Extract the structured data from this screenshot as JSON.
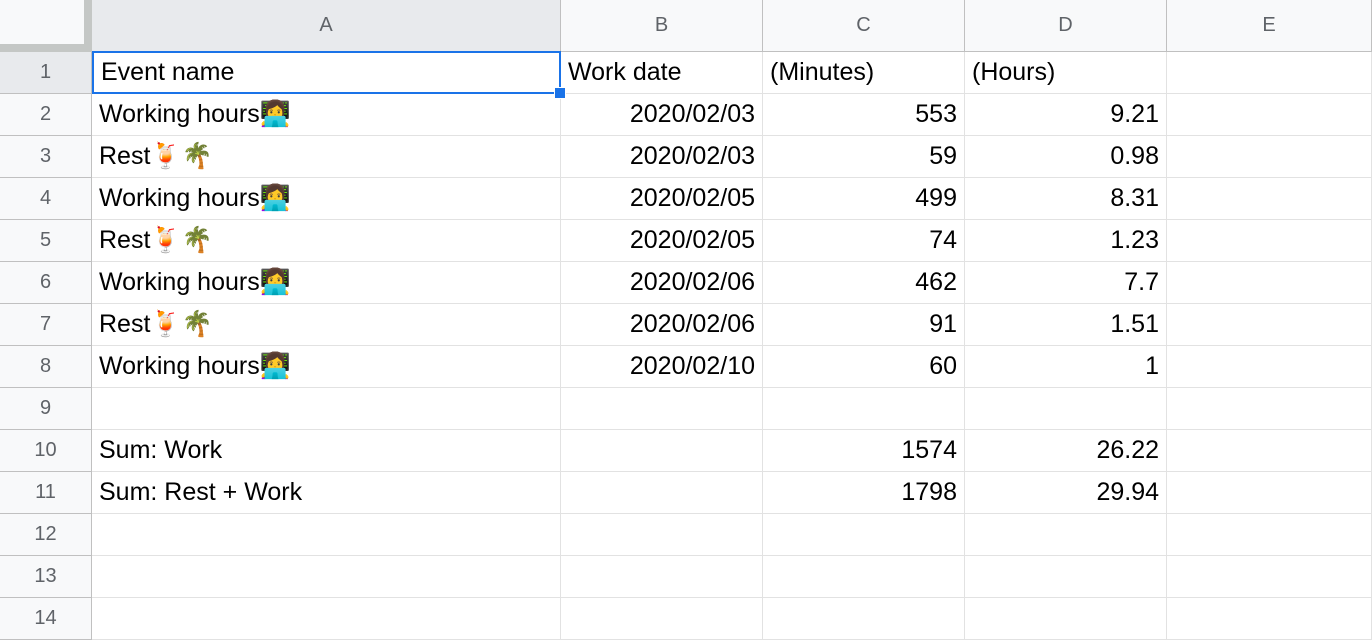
{
  "sheet": {
    "columns": [
      "A",
      "B",
      "C",
      "D",
      "E"
    ],
    "row_numbers": [
      "1",
      "2",
      "3",
      "4",
      "5",
      "6",
      "7",
      "8",
      "9",
      "10",
      "11",
      "12",
      "13",
      "14"
    ],
    "active_cell": "A1",
    "rows": [
      [
        "Event name",
        "Work date",
        "(Minutes)",
        "(Hours)",
        ""
      ],
      [
        "Working hours👩‍💻",
        "2020/02/03",
        "553",
        "9.21",
        ""
      ],
      [
        "Rest🍹🌴",
        "2020/02/03",
        "59",
        "0.98",
        ""
      ],
      [
        "Working hours👩‍💻",
        "2020/02/05",
        "499",
        "8.31",
        ""
      ],
      [
        "Rest🍹🌴",
        "2020/02/05",
        "74",
        "1.23",
        ""
      ],
      [
        "Working hours👩‍💻",
        "2020/02/06",
        "462",
        "7.7",
        ""
      ],
      [
        "Rest🍹🌴",
        "2020/02/06",
        "91",
        "1.51",
        ""
      ],
      [
        "Working hours👩‍💻",
        "2020/02/10",
        "60",
        "1",
        ""
      ],
      [
        "",
        "",
        "",
        "",
        ""
      ],
      [
        "Sum: Work",
        "",
        "1574",
        "26.22",
        ""
      ],
      [
        "Sum: Rest + Work",
        "",
        "1798",
        "29.94",
        ""
      ],
      [
        "",
        "",
        "",
        "",
        ""
      ],
      [
        "",
        "",
        "",
        "",
        ""
      ],
      [
        "",
        "",
        "",
        "",
        ""
      ]
    ]
  },
  "colors": {
    "header_bg": "#f8f9fa",
    "selected_header_bg": "#e8eaed",
    "selection_border": "#1a73e8",
    "gridline": "#e2e2e2"
  }
}
